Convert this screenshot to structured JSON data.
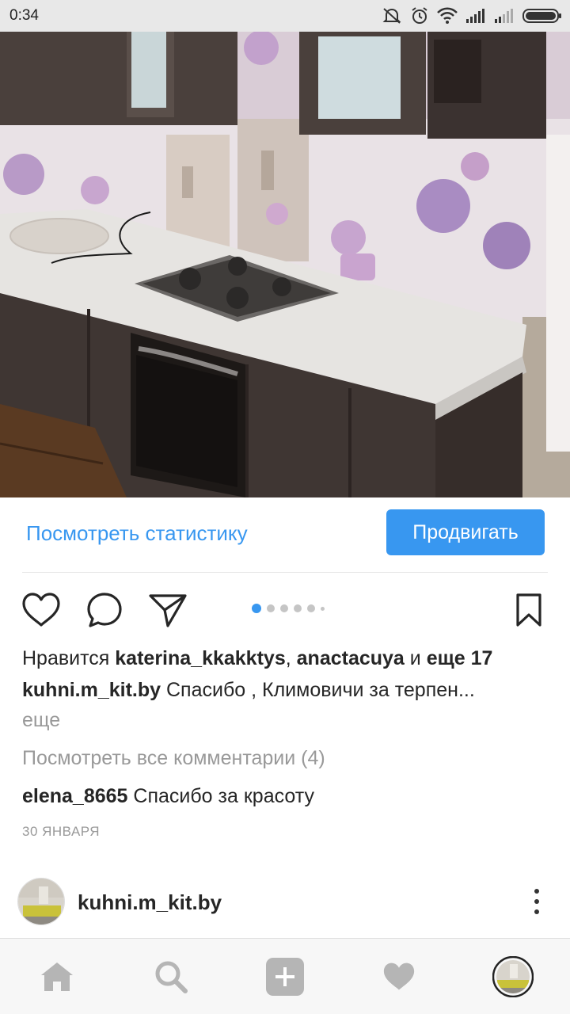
{
  "status_bar": {
    "time": "0:34",
    "icons": [
      "mute-icon",
      "alarm-icon",
      "wifi-icon",
      "signal-icon",
      "signal-icon",
      "battery-icon"
    ]
  },
  "post": {
    "photo": {
      "icon": "kitchen-photo"
    },
    "promo": {
      "stats_link": "Посмотреть статистику",
      "promote_button": "Продвигать"
    },
    "carousel": {
      "count": 6,
      "active": 0,
      "color": "#3897f0"
    },
    "likes": {
      "prefix": "Нравится",
      "user1": "katerina_kkakktys",
      "separator": ",",
      "user2": "anactacuya",
      "conj": "и",
      "others": "еще 17"
    },
    "caption": {
      "username": "kuhni.m_kit.by",
      "text": "Спасибо , Климовичи за терпен...",
      "more": "еще"
    },
    "view_comments": "Посмотреть все комментарии (4)",
    "comment": {
      "username": "elena_8665",
      "text": "Спасибо за красоту"
    },
    "date": "30 ЯНВАРЯ"
  },
  "next_post": {
    "username": "kuhni.m_kit.by"
  },
  "nav": {
    "items": [
      "home-icon",
      "search-icon",
      "add-post-icon",
      "activity-icon",
      "profile-icon"
    ]
  },
  "colors": {
    "accent": "#3897f0",
    "muted": "#999999",
    "text": "#262626"
  }
}
